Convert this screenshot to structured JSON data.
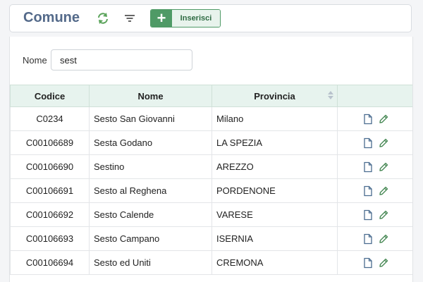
{
  "header": {
    "title": "Comune",
    "refresh_icon": "refresh-icon",
    "filter_icon": "filter-icon",
    "add_button_label": "Inserisci",
    "add_icon": "+",
    "accent_color": "#4f9a66",
    "title_color": "#546a8a"
  },
  "filter": {
    "label": "Nome",
    "value": "sest"
  },
  "table": {
    "columns": [
      "Codice",
      "Nome",
      "Provincia",
      ""
    ],
    "sorted_column": "Provincia",
    "rows": [
      {
        "code": "C0234",
        "name": "Sesto San Giovanni",
        "province": "Milano"
      },
      {
        "code": "C00106689",
        "name": "Sesta Godano",
        "province": "LA SPEZIA"
      },
      {
        "code": "C00106690",
        "name": "Sestino",
        "province": "AREZZO"
      },
      {
        "code": "C00106691",
        "name": "Sesto al Reghena",
        "province": "PORDENONE"
      },
      {
        "code": "C00106692",
        "name": "Sesto Calende",
        "province": "VARESE"
      },
      {
        "code": "C00106693",
        "name": "Sesto Campano",
        "province": "ISERNIA"
      },
      {
        "code": "C00106694",
        "name": "Sesto ed Uniti",
        "province": "CREMONA"
      }
    ],
    "row_action_icons": [
      "document-icon",
      "pencil-icon"
    ]
  }
}
